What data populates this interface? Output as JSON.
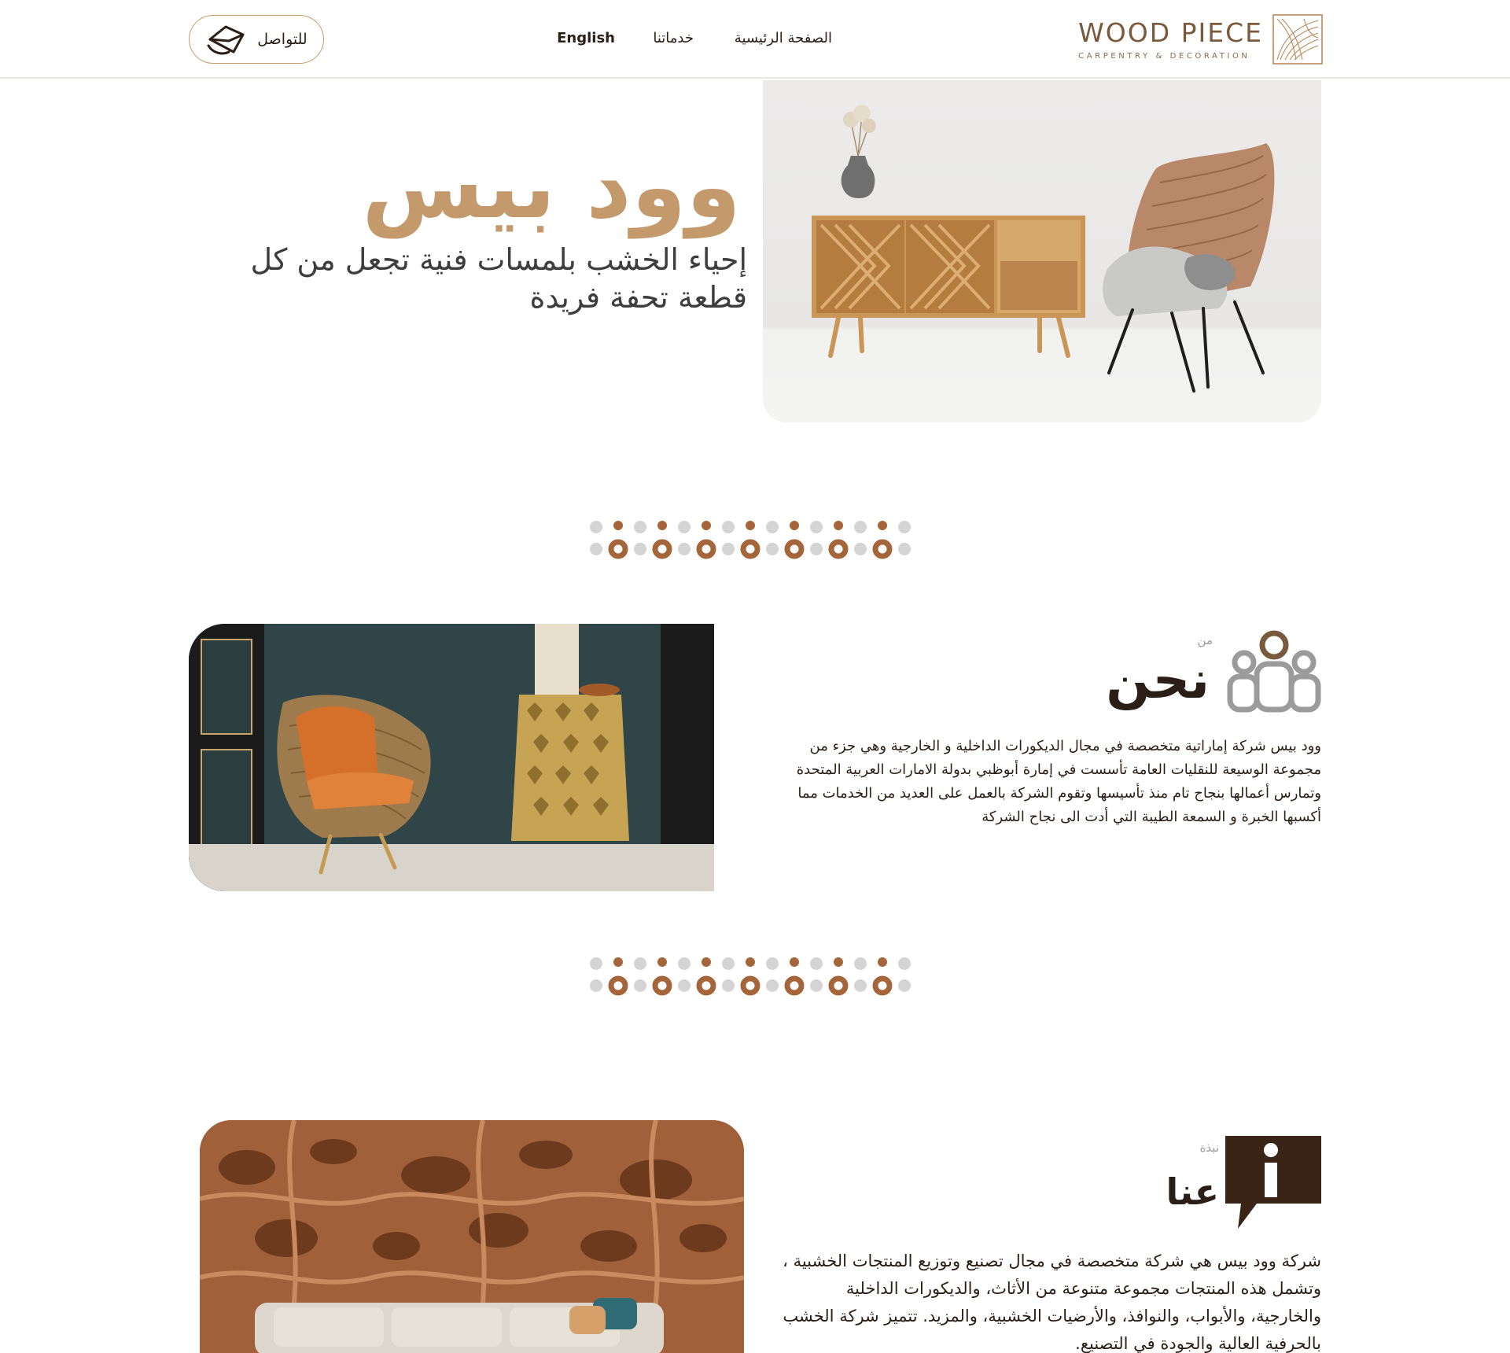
{
  "brand": {
    "name": "WOOD PIECE",
    "tagline": "CARPENTRY & DECORATION"
  },
  "nav": {
    "home": "الصفحة الرئيسية",
    "services": "خدماتنا",
    "language": "English"
  },
  "contact_button": {
    "label": "للتواصل",
    "icon": "envelope-icon"
  },
  "hero": {
    "title": "وود بيس",
    "subtitle": "إحياء الخشب بلمسات فنية تجعل من كل قطعة تحفة فريدة"
  },
  "who_we_are": {
    "pre_label": "من",
    "title": "نحن",
    "icon": "team-icon",
    "text": "وود بيس شركة إماراتية متخصصة في مجال الديكورات الداخلية و الخارجية وهي جزء من مجموعة الوسيعة للنقليات العامة تأسست في إمارة أبوظبي بدولة الامارات العربية المتحدة وتمارس أعمالها بنجاح تام منذ تأسيسها وتقوم الشركة بالعمل على العديد من الخدمات مما أكسبها الخبرة و السمعة الطيبة التي أدت الى نجاح الشركة"
  },
  "about": {
    "pre_label": "نبذة",
    "title": "عنا",
    "icon": "info-speech-icon",
    "text": "شركة وود بيس هي شركة متخصصة في مجال تصنيع وتوزيع المنتجات الخشبية ، وتشمل هذه المنتجات مجموعة متنوعة من الأثاث، والديكورات الداخلية والخارجية، والأبواب، والنوافذ، والأرضيات الخشبية، والمزيد. تتميز شركة الخشب بالحرفية العالية والجودة في التصنيع."
  },
  "colors": {
    "accent": "#c49a6c",
    "dark": "#2a1e16",
    "divider_brown": "#a5653a",
    "divider_gray": "#d4d4d4"
  }
}
